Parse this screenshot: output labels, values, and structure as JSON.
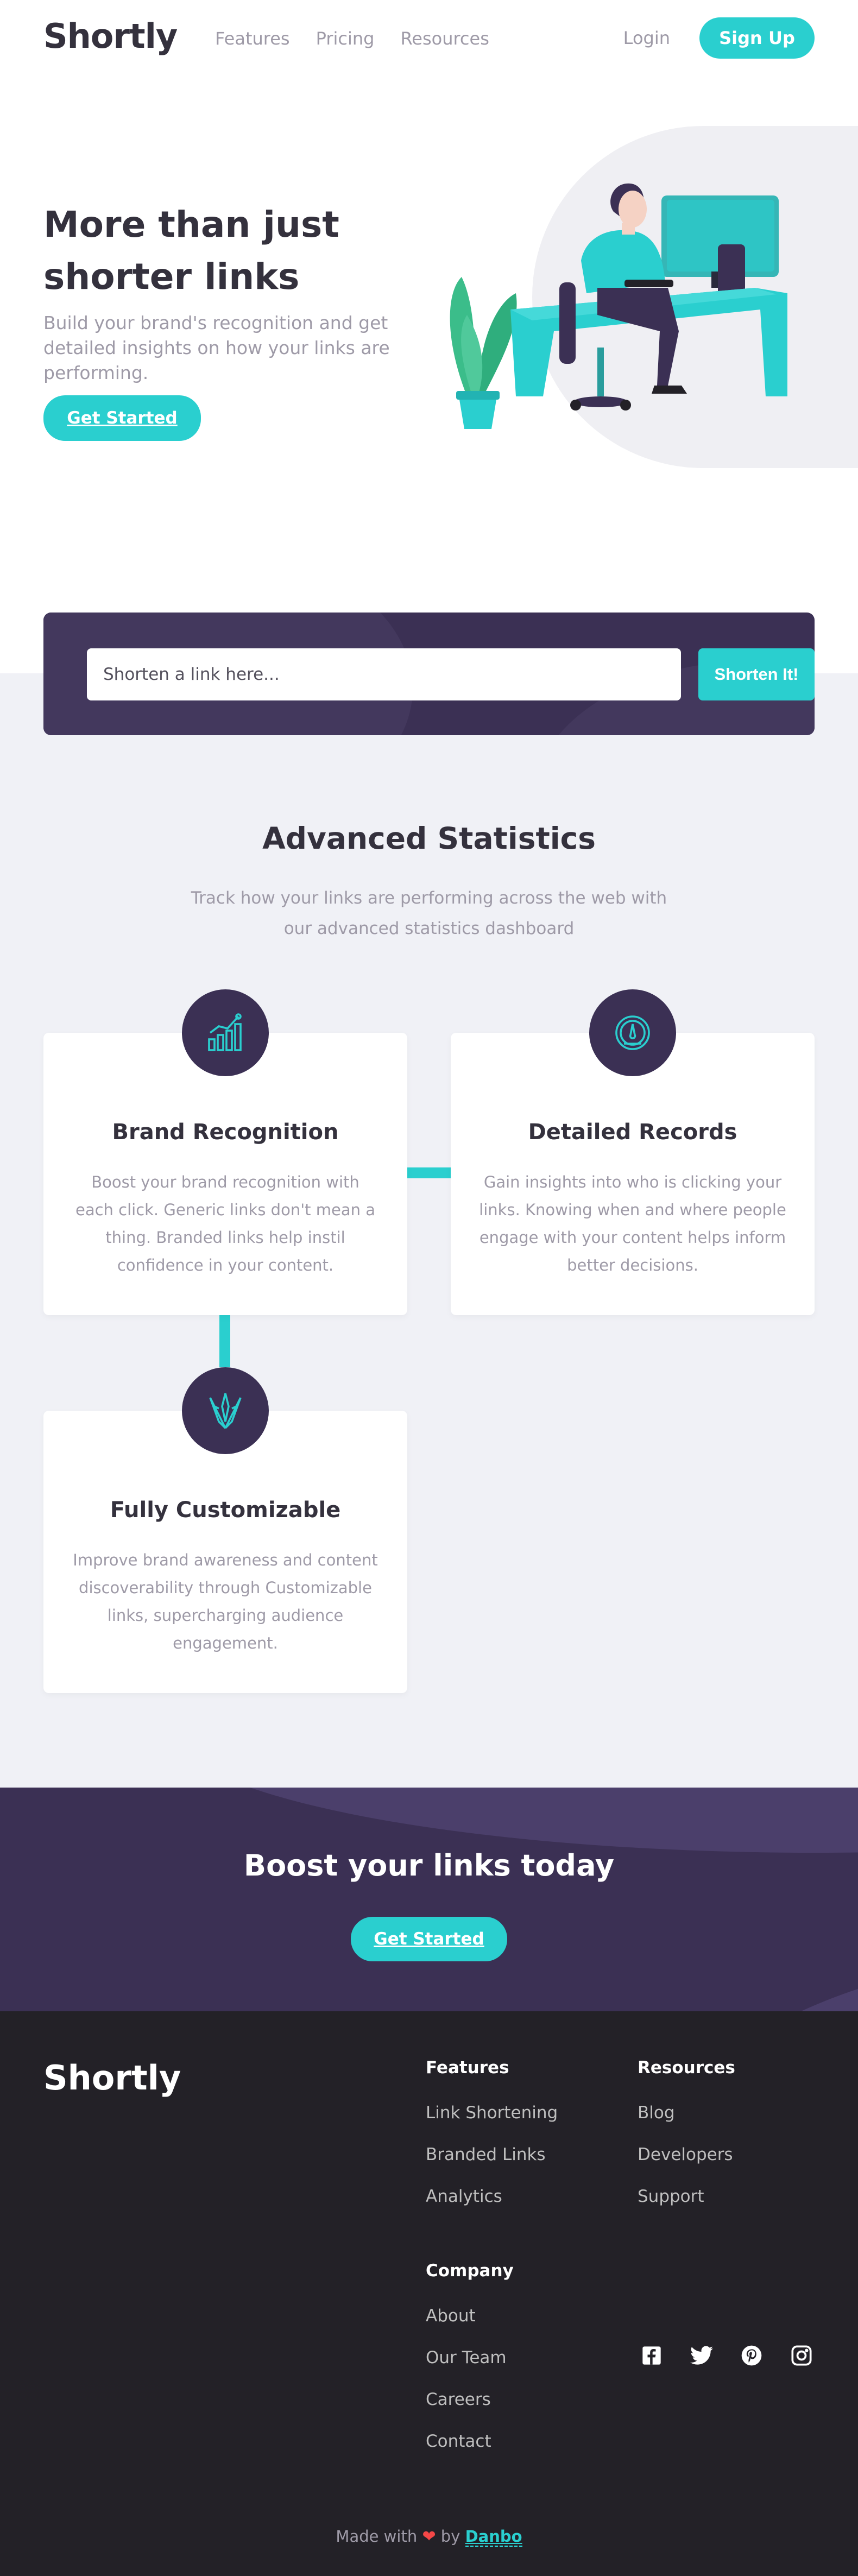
{
  "header": {
    "logo": "Shortly",
    "nav": [
      "Features",
      "Pricing",
      "Resources"
    ],
    "login": "Login",
    "signup": "Sign Up"
  },
  "hero": {
    "title": "More than just shorter links",
    "description": "Build your brand's recognition and get detailed insights on how your links are performing.",
    "cta": "Get Started"
  },
  "shorten": {
    "placeholder": "Shorten a link here...",
    "button": "Shorten It!"
  },
  "stats": {
    "title": "Advanced Statistics",
    "description": "Track how your links are performing across the web with our advanced statistics dashboard",
    "cards": [
      {
        "icon": "bar-chart-icon",
        "title": "Brand Recognition",
        "text": "Boost your brand recognition with each click. Generic links don't mean a thing. Branded links help instil confidence in your content."
      },
      {
        "icon": "speedometer-icon",
        "title": "Detailed Records",
        "text": "Gain insights into who is clicking your links. Knowing when and where people engage with your content helps inform better decisions."
      },
      {
        "icon": "brush-pen-icon",
        "title": "Fully Customizable",
        "text": "Improve brand awareness and content discoverability through Customizable links, supercharging audience engagement."
      }
    ]
  },
  "boost": {
    "title": "Boost your links today",
    "cta": "Get Started"
  },
  "footer": {
    "logo": "Shortly",
    "features": {
      "title": "Features",
      "links": [
        "Link Shortening",
        "Branded Links",
        "Analytics"
      ]
    },
    "resources": {
      "title": "Resources",
      "links": [
        "Blog",
        "Developers",
        "Support"
      ]
    },
    "company": {
      "title": "Company",
      "links": [
        "About",
        "Our Team",
        "Careers",
        "Contact"
      ]
    },
    "social": [
      "facebook-icon",
      "twitter-icon",
      "pinterest-icon",
      "instagram-icon"
    ],
    "made_prefix": "Made with",
    "made_by": "by",
    "author": "Danbo"
  },
  "colors": {
    "cyan": "#2acfcf",
    "dark_violet": "#3b3054",
    "very_dark_violet": "#232127",
    "gray": "#9e9aa7",
    "light_bg": "#f0f1f6",
    "heart": "#f44747"
  }
}
